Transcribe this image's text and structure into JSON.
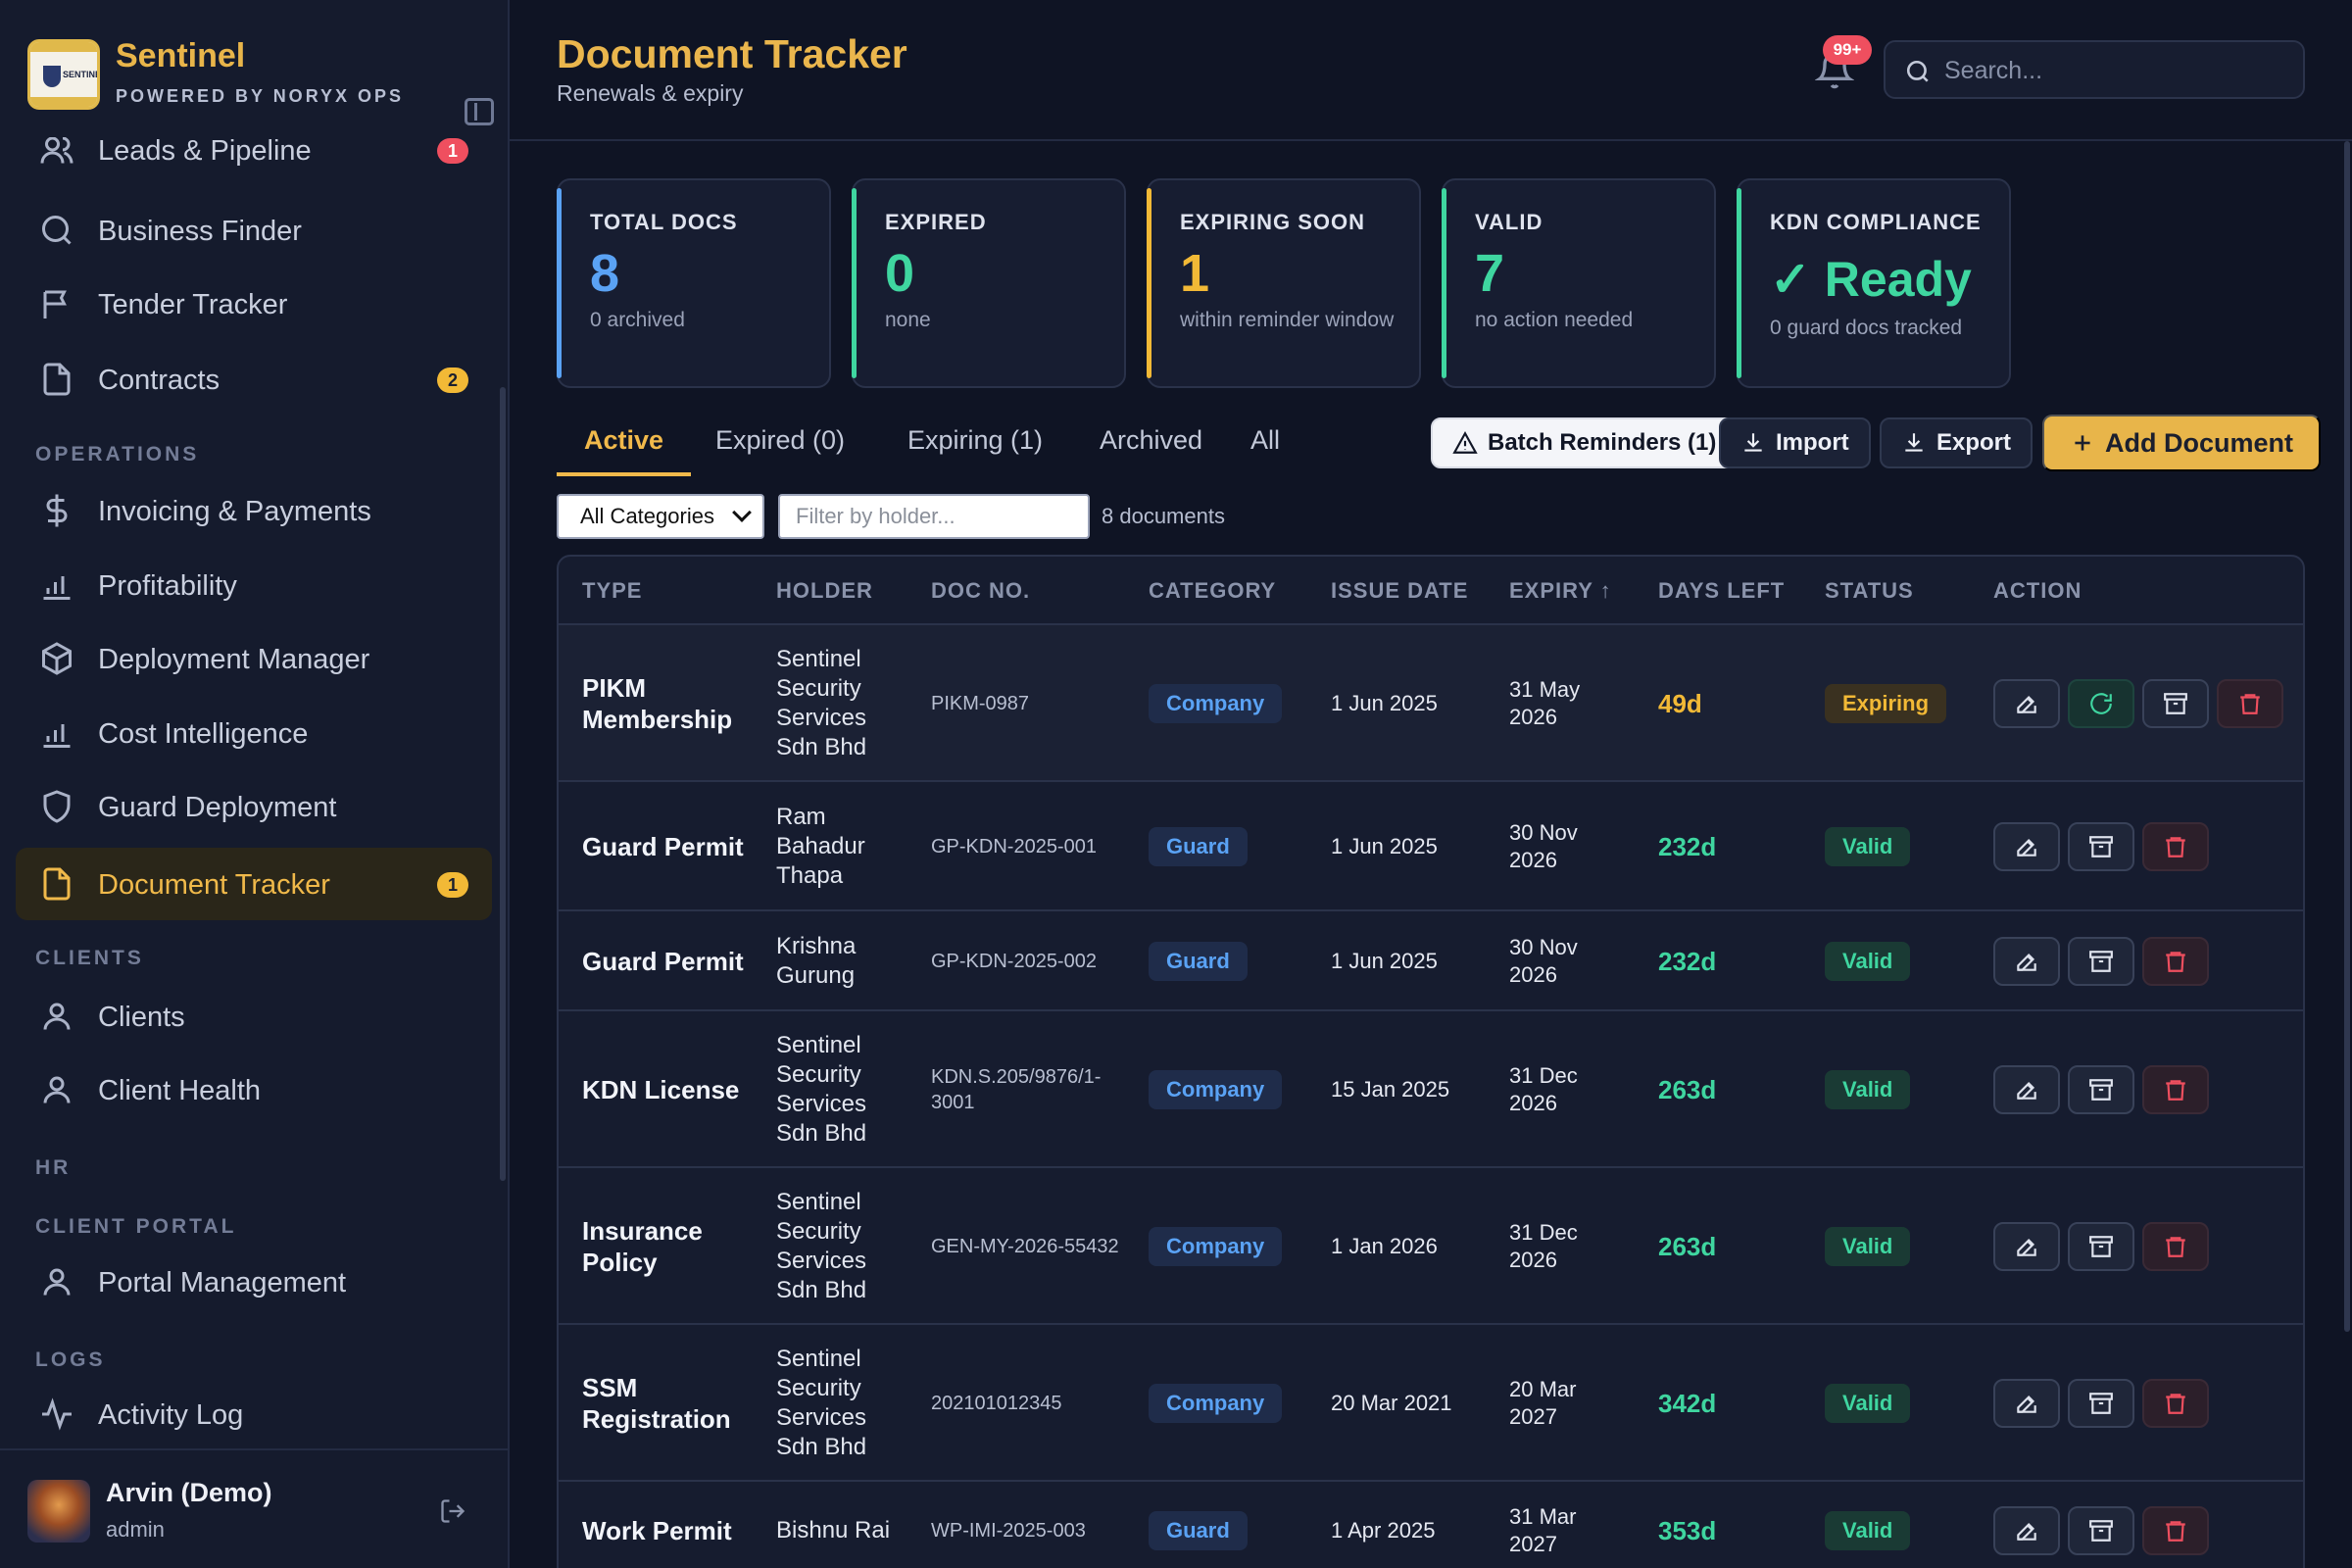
{
  "brand": {
    "name": "Sentinel",
    "tagline": "POWERED BY NORYX OPS",
    "logo_text": "SENTINEL"
  },
  "sidebar": {
    "items": [
      {
        "label": "Leads & Pipeline",
        "icon": "users-icon",
        "badge": "1",
        "badge_color": "#ef4f5f"
      },
      {
        "label": "Business Finder",
        "icon": "search-icon"
      },
      {
        "label": "Tender Tracker",
        "icon": "flag-icon"
      },
      {
        "label": "Contracts",
        "icon": "file-icon",
        "badge": "2",
        "badge_color": "#f2b936"
      },
      {
        "label": "Invoicing & Payments",
        "icon": "dollar-icon"
      },
      {
        "label": "Profitability",
        "icon": "bar-chart-icon"
      },
      {
        "label": "Deployment Manager",
        "icon": "box-icon"
      },
      {
        "label": "Cost Intelligence",
        "icon": "bar-chart-icon"
      },
      {
        "label": "Guard Deployment",
        "icon": "shield-icon"
      },
      {
        "label": "Document Tracker",
        "icon": "file-icon",
        "badge": "1",
        "badge_color": "#f2b936",
        "active": true
      },
      {
        "label": "Clients",
        "icon": "user-icon"
      },
      {
        "label": "Client Health",
        "icon": "user-icon"
      },
      {
        "label": "Portal Management",
        "icon": "user-icon"
      },
      {
        "label": "Activity Log",
        "icon": "activity-icon"
      }
    ],
    "sections": [
      "OPERATIONS",
      "CLIENTS",
      "HR",
      "CLIENT PORTAL",
      "LOGS"
    ]
  },
  "user": {
    "name": "Arvin (Demo)",
    "role": "admin"
  },
  "header": {
    "title": "Document Tracker",
    "subtitle": "Renewals & expiry",
    "notification_badge": "99+",
    "search_placeholder": "Search..."
  },
  "stats": [
    {
      "label": "TOTAL DOCS",
      "value": "8",
      "sub": "0 archived",
      "color": "#5aa2f4"
    },
    {
      "label": "EXPIRED",
      "value": "0",
      "sub": "none",
      "color": "#3fd6a0"
    },
    {
      "label": "EXPIRING SOON",
      "value": "1",
      "sub": "within reminder window",
      "color": "#f2b936"
    },
    {
      "label": "VALID",
      "value": "7",
      "sub": "no action needed",
      "color": "#3fd6a0"
    },
    {
      "label": "KDN COMPLIANCE",
      "value": "✓ Ready",
      "sub": "0 guard docs tracked",
      "color": "#3fd6a0"
    }
  ],
  "tabs": [
    "Active",
    "Expired (0)",
    "Expiring (1)",
    "Archived",
    "All"
  ],
  "toolbar": {
    "batch_label": "Batch Reminders (1)",
    "import_label": "Import",
    "export_label": "Export",
    "add_label": "Add Document"
  },
  "filters": {
    "category_selected": "All Categories",
    "holder_placeholder": "Filter by holder...",
    "count_text": "8 documents"
  },
  "table": {
    "headers": [
      "TYPE",
      "HOLDER",
      "DOC NO.",
      "CATEGORY",
      "ISSUE DATE",
      "EXPIRY ↑",
      "DAYS LEFT",
      "STATUS",
      "ACTION"
    ],
    "rows": [
      {
        "type": "PIKM Membership",
        "holder": "Sentinel Security Services Sdn Bhd",
        "doc_no": "PIKM-0987",
        "category": "Company",
        "issue": "1 Jun 2025",
        "expiry": "31 May 2026",
        "days": "49d",
        "days_color": "#f2b936",
        "status": "Expiring"
      },
      {
        "type": "Guard Permit",
        "holder": "Ram Bahadur Thapa",
        "doc_no": "GP-KDN-2025-001",
        "category": "Guard",
        "issue": "1 Jun 2025",
        "expiry": "30 Nov 2026",
        "days": "232d",
        "days_color": "#3fd6a0",
        "status": "Valid"
      },
      {
        "type": "Guard Permit",
        "holder": "Krishna Gurung",
        "doc_no": "GP-KDN-2025-002",
        "category": "Guard",
        "issue": "1 Jun 2025",
        "expiry": "30 Nov 2026",
        "days": "232d",
        "days_color": "#3fd6a0",
        "status": "Valid"
      },
      {
        "type": "KDN License",
        "holder": "Sentinel Security Services Sdn Bhd",
        "doc_no": "KDN.S.205/9876/1-3001",
        "category": "Company",
        "issue": "15 Jan 2025",
        "expiry": "31 Dec 2026",
        "days": "263d",
        "days_color": "#3fd6a0",
        "status": "Valid"
      },
      {
        "type": "Insurance Policy",
        "holder": "Sentinel Security Services Sdn Bhd",
        "doc_no": "GEN-MY-2026-55432",
        "category": "Company",
        "issue": "1 Jan 2026",
        "expiry": "31 Dec 2026",
        "days": "263d",
        "days_color": "#3fd6a0",
        "status": "Valid"
      },
      {
        "type": "SSM Registration",
        "holder": "Sentinel Security Services Sdn Bhd",
        "doc_no": "202101012345",
        "category": "Company",
        "issue": "20 Mar 2021",
        "expiry": "20 Mar 2027",
        "days": "342d",
        "days_color": "#3fd6a0",
        "status": "Valid"
      },
      {
        "type": "Work Permit",
        "holder": "Bishnu Rai",
        "doc_no": "WP-IMI-2025-003",
        "category": "Guard",
        "issue": "1 Apr 2025",
        "expiry": "31 Mar 2027",
        "days": "353d",
        "days_color": "#3fd6a0",
        "status": "Valid"
      }
    ]
  }
}
